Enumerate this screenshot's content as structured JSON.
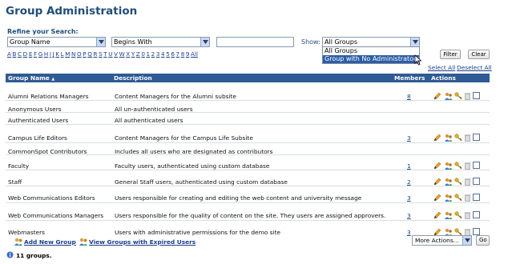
{
  "page_title": "Group Administration",
  "refine": {
    "label": "Refine your Search:",
    "field": "Group Name",
    "operator": "Begins With",
    "query_value": "",
    "show_label": "Show:",
    "show_value": "All Groups",
    "show_options": [
      "All Groups",
      "Group with No Administrators"
    ],
    "show_highlighted_option": "Group with No Administrators",
    "filter_label": "Filter",
    "clear_label": "Clear"
  },
  "alphabet": [
    "A",
    "B",
    "C",
    "D",
    "E",
    "F",
    "G",
    "H",
    "I",
    "J",
    "K",
    "L",
    "M",
    "N",
    "O",
    "P",
    "Q",
    "R",
    "S",
    "T",
    "U",
    "V",
    "W",
    "X",
    "Y",
    "Z",
    "0",
    "1",
    "2",
    "3",
    "4",
    "5",
    "6",
    "7",
    "8",
    "9",
    "All"
  ],
  "selection": {
    "select_all": "Select All",
    "deselect_all": "Deselect All"
  },
  "table": {
    "headers": {
      "group_name": "Group Name",
      "sort_indicator": "▲",
      "description": "Description",
      "members": "Members",
      "actions": "Actions"
    },
    "rows": [
      {
        "name": "Alumni Relations Managers",
        "description": "Content Managers for the Alumni subsite",
        "members": "8",
        "has_actions": true
      },
      {
        "name": "Anonymous Users",
        "description": "All un-authenticated users",
        "members": "",
        "has_actions": false
      },
      {
        "name": "Authenticated Users",
        "description": "All authenticated users",
        "members": "",
        "has_actions": false
      },
      {
        "name": "Campus Life Editors",
        "description": "Content Managers for the Campus Life Subsite",
        "members": "3",
        "has_actions": true
      },
      {
        "name": "CommonSpot Contributors",
        "description": "Includes all users who are designated as contributors",
        "members": "",
        "has_actions": false
      },
      {
        "name": "Faculty",
        "description": "Faculty users, authenticated using custom database",
        "members": "1",
        "has_actions": true
      },
      {
        "name": "Staff",
        "description": "General Staff users, authenticated using custom database",
        "members": "2",
        "has_actions": true
      },
      {
        "name": "Web Communications Editors",
        "description": "Users responsible for creating and editing the web content and university message",
        "members": "3",
        "has_actions": true
      },
      {
        "name": "Web Communications Managers",
        "description": "Users responsible for the quality of content on the site. They users are assigned approvers.",
        "members": "3",
        "has_actions": true
      },
      {
        "name": "Webmasters",
        "description": "Users with administrative permissions for the demo site",
        "members": "3",
        "has_actions": true
      }
    ]
  },
  "footer": {
    "add_new_group": "Add New Group",
    "view_expired": "View Groups with Expired Users",
    "more_actions": "More Actions...",
    "go_label": "Go",
    "count_text": "11 groups."
  },
  "colors": {
    "header_bg": "#2f5b94",
    "title": "#1f4e79",
    "link": "#1a3f8a",
    "highlight": "#2c5da6"
  }
}
